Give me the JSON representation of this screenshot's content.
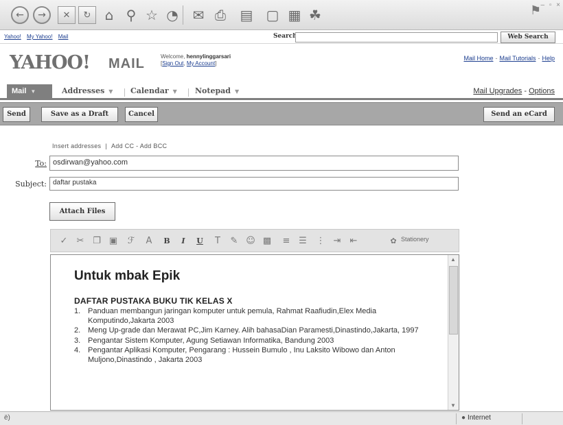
{
  "browser": {
    "status_left": "ë)",
    "zone": "Internet",
    "icons": [
      "back-icon",
      "forward-icon",
      "stop-icon",
      "refresh-icon",
      "home-icon",
      "search-icon",
      "favorites-icon",
      "history-icon",
      "mail-icon",
      "print-icon",
      "edit-icon",
      "discuss-icon",
      "research-icon",
      "messenger-icon"
    ]
  },
  "yahoo_links": [
    "Yahoo!",
    "My Yahoo!",
    "Mail"
  ],
  "search": {
    "label": "Search:",
    "value": "",
    "button": "Web Search"
  },
  "header": {
    "logo": "YAHOO!",
    "product": "MAIL",
    "welcome_prefix": "Welcome,",
    "username": "hennylinggarsari",
    "sign_out": "Sign Out",
    "my_account": "My Account",
    "links": [
      "Mail Home",
      "Mail Tutorials",
      "Help"
    ]
  },
  "tabs": {
    "mail": "Mail",
    "addresses": "Addresses",
    "calendar": "Calendar",
    "notepad": "Notepad",
    "mail_upgrades": "Mail Upgrades",
    "options": "Options"
  },
  "actions": {
    "send": "Send",
    "save_draft": "Save as a Draft",
    "cancel": "Cancel",
    "send_ecard": "Send an eCard"
  },
  "compose": {
    "insert_addresses": "Insert addresses",
    "add_cc_bcc": "Add CC - Add BCC",
    "to_label": "To:",
    "to_value": "osdirwan@yahoo.com",
    "subject_label": "Subject:",
    "subject_value": "daftar pustaka",
    "attach_files": "Attach Files",
    "stationery": "Stationery"
  },
  "message": {
    "heading": "Untuk mbak Epik",
    "list_title": "DAFTAR PUSTAKA BUKU TIK KELAS X",
    "items": [
      {
        "num": "1.",
        "text": "Panduan membangun jaringan komputer untuk pemula, Rahmat Raafiudin,Elex Media Komputindo,Jakarta 2003"
      },
      {
        "num": "2.",
        "text": "Meng Up-grade dan Merawat PC,Jim Karney. Alih bahasaDian Paramesti,Dinastindo,Jakarta, 1997"
      },
      {
        "num": "3.",
        "text": "Pengantar Sistem Komputer, Agung Setiawan Informatika, Bandung 2003"
      },
      {
        "num": "4.",
        "text": "Pengantar Aplikasi Komputer, Pengarang : Hussein Bumulo , Inu Laksito Wibowo dan Anton Muljono,Dinastindo , Jakarta 2003"
      }
    ]
  }
}
